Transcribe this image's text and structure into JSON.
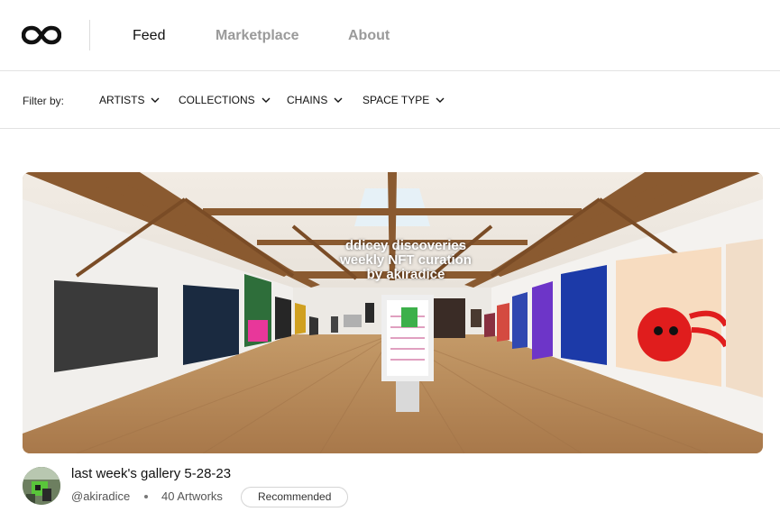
{
  "header": {
    "nav": {
      "feed": "Feed",
      "marketplace": "Marketplace",
      "about": "About"
    }
  },
  "filters": {
    "label": "Filter by:",
    "items": [
      "ARTISTS",
      "COLLECTIONS",
      "CHAINS",
      "SPACE TYPE"
    ]
  },
  "gallery": {
    "overlay_lines": [
      "ddicey discoveries",
      "weekly NFT curation",
      "by akiradice"
    ],
    "title": "last week's gallery 5-28-23",
    "user": "@akiradice",
    "artworks": "40 Artworks",
    "badge": "Recommended"
  },
  "colors": {
    "nav_active": "#111111",
    "nav_inactive": "#9a9a9a",
    "divider": "#e2e2e2"
  },
  "icons": {
    "logo": "infinity-logo-icon",
    "dropdown": "chevron-down-icon"
  }
}
